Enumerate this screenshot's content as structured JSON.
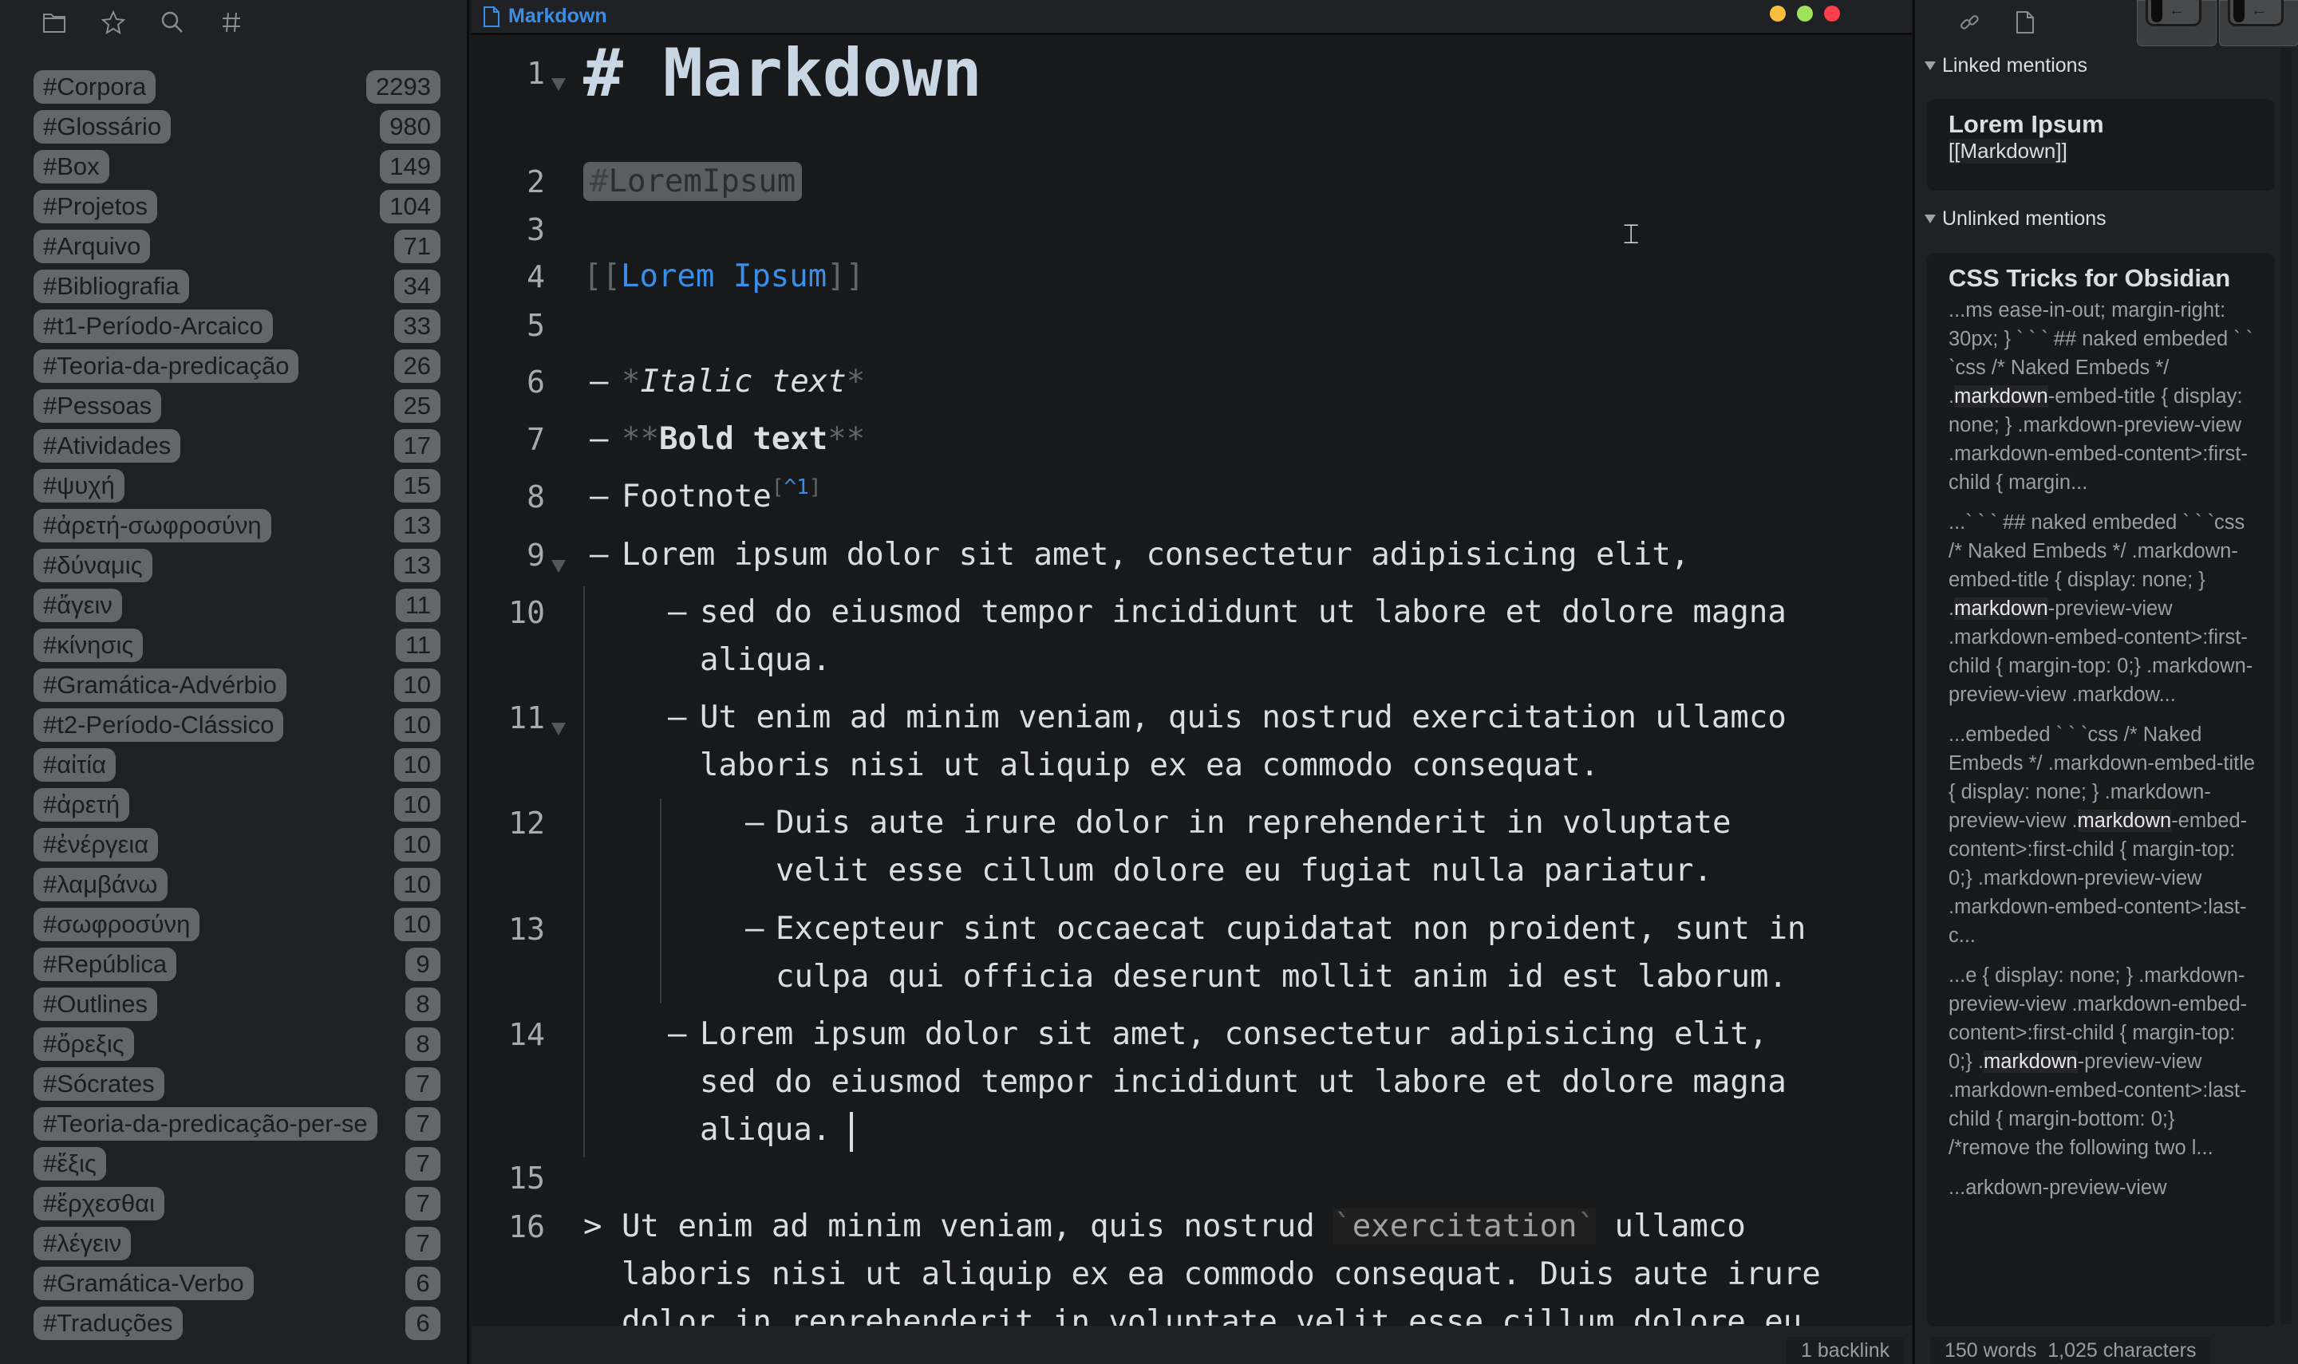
{
  "sidebar": {
    "icons": [
      "folder-icon",
      "star-icon",
      "search-icon",
      "hash-icon"
    ],
    "tags": [
      {
        "label": "#Corpora",
        "count": "2293"
      },
      {
        "label": "#Glossário",
        "count": "980"
      },
      {
        "label": "#Box",
        "count": "149"
      },
      {
        "label": "#Projetos",
        "count": "104"
      },
      {
        "label": "#Arquivo",
        "count": "71"
      },
      {
        "label": "#Bibliografia",
        "count": "34"
      },
      {
        "label": "#t1-Período-Arcaico",
        "count": "33"
      },
      {
        "label": "#Teoria-da-predicação",
        "count": "26"
      },
      {
        "label": "#Pessoas",
        "count": "25"
      },
      {
        "label": "#Atividades",
        "count": "17"
      },
      {
        "label": "#ψυχή",
        "count": "15"
      },
      {
        "label": "#ἀρετή-σωφροσύνη",
        "count": "13"
      },
      {
        "label": "#δύναμις",
        "count": "13"
      },
      {
        "label": "#ἄγειν",
        "count": "11"
      },
      {
        "label": "#κίνησις",
        "count": "11"
      },
      {
        "label": "#Gramática-Advérbio",
        "count": "10"
      },
      {
        "label": "#t2-Período-Clássico",
        "count": "10"
      },
      {
        "label": "#αἰτία",
        "count": "10"
      },
      {
        "label": "#ἀρετή",
        "count": "10"
      },
      {
        "label": "#ἐνέργεια",
        "count": "10"
      },
      {
        "label": "#λαμβάνω",
        "count": "10"
      },
      {
        "label": "#σωφροσύνη",
        "count": "10"
      },
      {
        "label": "#República",
        "count": "9"
      },
      {
        "label": "#Outlines",
        "count": "8"
      },
      {
        "label": "#ὄρεξις",
        "count": "8"
      },
      {
        "label": "#Sócrates",
        "count": "7"
      },
      {
        "label": "#Teoria-da-predicação-per-se",
        "count": "7"
      },
      {
        "label": "#ἕξις",
        "count": "7"
      },
      {
        "label": "#ἔρχεσθαι",
        "count": "7"
      },
      {
        "label": "#λέγειν",
        "count": "7"
      },
      {
        "label": "#Gramática-Verbo",
        "count": "6"
      },
      {
        "label": "#Traduções",
        "count": "6"
      }
    ]
  },
  "editor": {
    "tab_title": "Markdown",
    "window_colors": {
      "minimize": "#fbbe3c",
      "maximize": "#9fe15a",
      "close": "#fc3f4a"
    },
    "line_numbers": [
      "1",
      "2",
      "3",
      "4",
      "5",
      "6",
      "7",
      "8",
      "9",
      "10",
      "11",
      "12",
      "13",
      "14",
      "15",
      "16"
    ],
    "heading": {
      "marker": "#",
      "text": "Markdown"
    },
    "tag": {
      "hash": "#",
      "text": "LoremIpsum"
    },
    "link": {
      "open": "[[",
      "text": "Lorem Ipsum",
      "close": "]]"
    },
    "bullet": "–",
    "italic": {
      "marker": "*",
      "text": "Italic text"
    },
    "bold": {
      "marker": "**",
      "text": "Bold text"
    },
    "footnote": {
      "text": "Footnote",
      "open": "[",
      "ref": "^1",
      "close": "]"
    },
    "list": [
      "Lorem ipsum dolor sit amet, consectetur adipisicing elit,",
      "sed do eiusmod tempor incididunt ut labore et dolore magna aliqua.",
      "Ut enim ad minim veniam, quis nostrud exercitation ullamco laboris nisi ut aliquip ex ea commodo consequat.",
      "Duis aute irure dolor in reprehenderit in voluptate velit esse cillum dolore eu fugiat nulla pariatur.",
      "Excepteur sint occaecat cupidatat non proident, sunt in culpa qui officia deserunt mollit anim id est laborum.",
      "Lorem ipsum dolor sit amet, consectetur adipisicing elit, sed do eiusmod tempor incididunt ut labore et dolore magna aliqua. "
    ],
    "quote": {
      "marker": ">",
      "before": "Ut enim ad minim veniam, quis nostrud ",
      "code_tick": "`",
      "code": "exercitation",
      "after": " ullamco laboris nisi ut aliquip ex ea commodo consequat. Duis aute irure dolor in reprehenderit in voluptate velit esse cillum dolore eu fugiat nulla"
    }
  },
  "right": {
    "icons": [
      "link-icon",
      "file-icon"
    ],
    "linked_label": "Linked mentions",
    "linked": {
      "title": "Lorem Ipsum",
      "text": "[[Markdown]]"
    },
    "unlinked_label": "Unlinked mentions",
    "unlinked": {
      "title": "CSS Tricks for Obsidian",
      "snippets": [
        {
          "before": "...ms ease-in-out; margin-right: 30px; } ` ` ` ## naked embeded ` ` `css /* Naked Embeds */ .",
          "hl": "markdown",
          "after": "-embed-title { display: none; } .markdown-preview-view .markdown-embed-content>:first-child { margin..."
        },
        {
          "before": "...` ` ` ## naked embeded ` ` `css /* Naked Embeds */ .markdown-embed-title { display: none; } .",
          "hl": "markdown",
          "after": "-preview-view .markdown-embed-content>:first-child { margin-top: 0;} .markdown-preview-view .markdow..."
        },
        {
          "before": "...embeded ` ` `css /* Naked Embeds */ .markdown-embed-title { display: none; } .markdown-preview-view .",
          "hl": "markdown",
          "after": "-embed-content>:first-child { margin-top: 0;} .markdown-preview-view .markdown-embed-content>:last-c..."
        },
        {
          "before": "...e { display: none; } .markdown-preview-view .markdown-embed-content>:first-child { margin-top: 0;} .",
          "hl": "markdown",
          "after": "-preview-view .markdown-embed-content>:last-child { margin-bottom: 0;} /*remove the following two l..."
        },
        {
          "before": "...arkdown-preview-view",
          "hl": "",
          "after": ""
        }
      ]
    }
  },
  "status": {
    "backlinks": "1 backlink",
    "words": "150 words",
    "characters": "1,025 characters"
  }
}
